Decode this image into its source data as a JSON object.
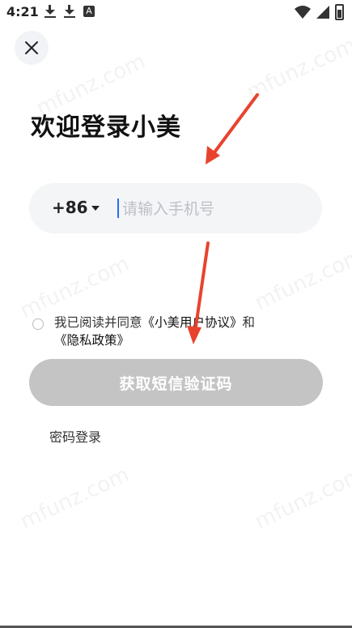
{
  "status_bar": {
    "time": "4:21",
    "a_label": "A"
  },
  "header": {
    "close_icon": "close-icon"
  },
  "title": "欢迎登录小美",
  "phone": {
    "country_code": "+86",
    "placeholder": "请输入手机号",
    "value": ""
  },
  "agreement": {
    "prefix": "我已阅读并同意",
    "user_agreement": "《小美用户协议》",
    "and": "和",
    "privacy_policy": "《隐私政策》"
  },
  "actions": {
    "get_code": "获取短信验证码",
    "password_login": "密码登录"
  },
  "watermark": "mfunz.com",
  "colors": {
    "button_disabled": "#c4c4c4",
    "cursor": "#2b6ef2",
    "annotation": "#e8432e"
  }
}
